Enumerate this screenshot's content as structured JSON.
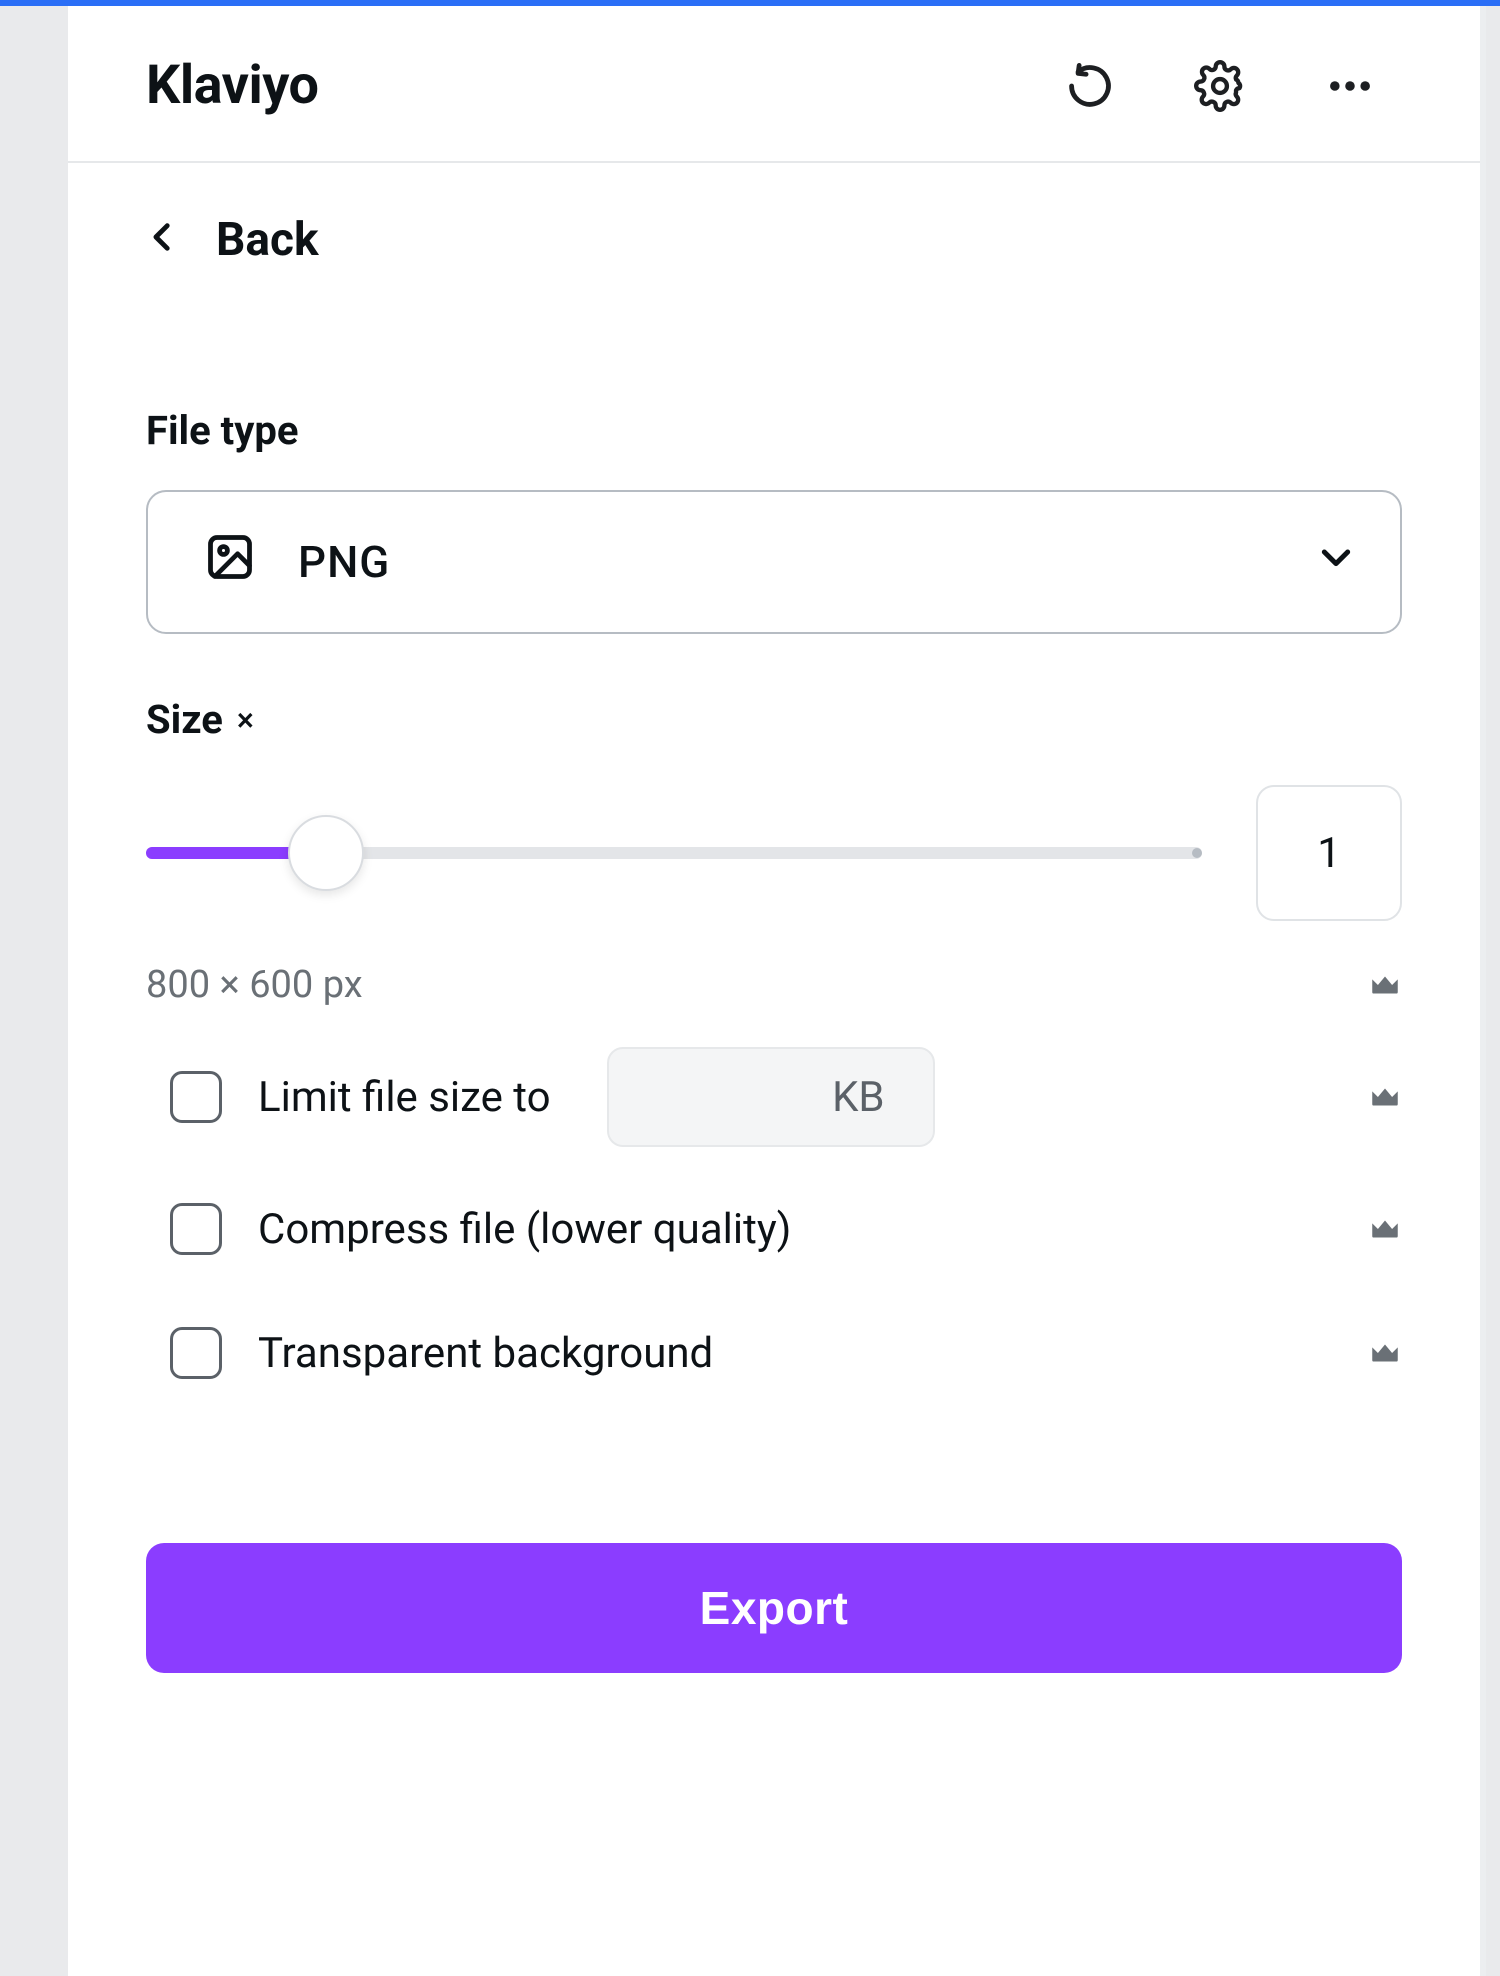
{
  "header": {
    "title": "Klaviyo"
  },
  "back": {
    "label": "Back"
  },
  "file_type": {
    "section_label": "File type",
    "selected": "PNG"
  },
  "size": {
    "section_label": "Size",
    "multiplier_symbol": "×",
    "value": "1",
    "dimensions": "800 × 600 px",
    "slider_percent": 17
  },
  "options": {
    "limit_size": {
      "label": "Limit file size to",
      "unit": "KB",
      "checked": false
    },
    "compress": {
      "label": "Compress file (lower quality)",
      "checked": false
    },
    "transparent": {
      "label": "Transparent background",
      "checked": false
    }
  },
  "export_button": "Export"
}
